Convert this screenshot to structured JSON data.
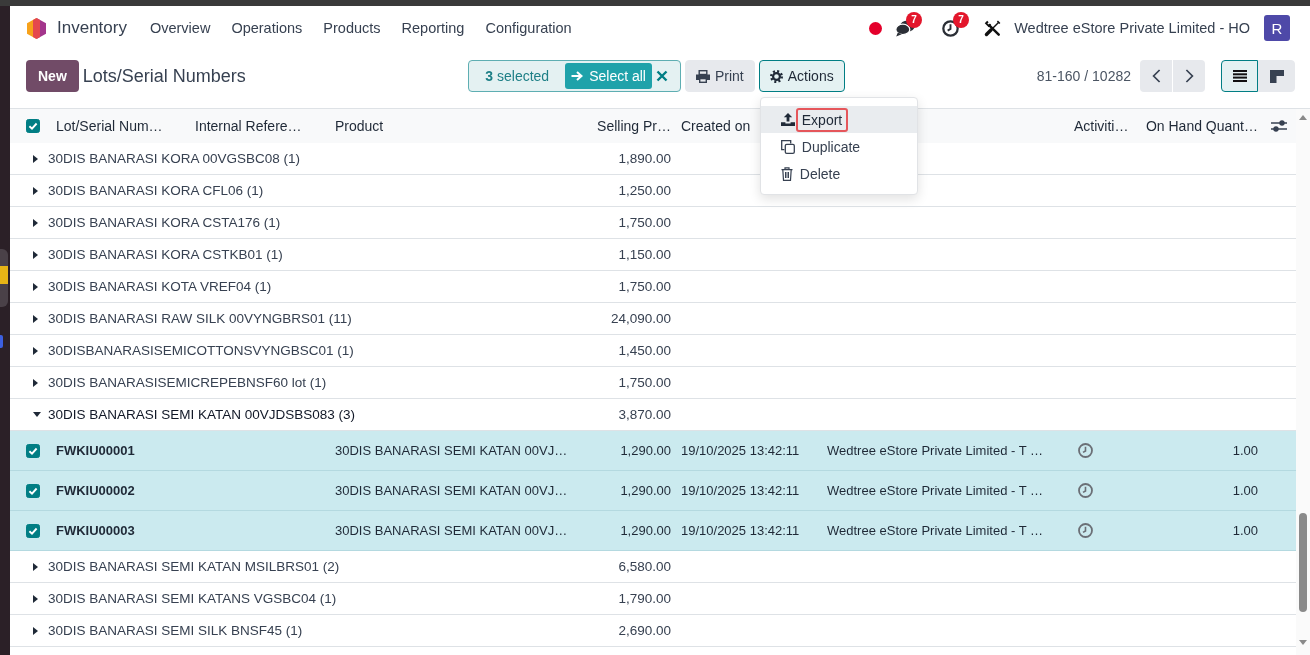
{
  "navbar": {
    "app_name": "Inventory",
    "menus": [
      "Overview",
      "Operations",
      "Products",
      "Reporting",
      "Configuration"
    ],
    "systray": [
      {
        "kind": "dot"
      },
      {
        "kind": "chat",
        "badge": "7"
      },
      {
        "kind": "activity",
        "badge": "7"
      },
      {
        "kind": "tools"
      }
    ],
    "company": "Wedtree eStore Private Limited - HO",
    "avatar_initial": "R"
  },
  "control_panel": {
    "new_button": "New",
    "title": "Lots/Serial Numbers",
    "selection": {
      "text": "**3** selected",
      "select_all": "Select all"
    },
    "buttons": [
      {
        "kind": "print",
        "label": "Print",
        "open": false
      },
      {
        "kind": "actions",
        "label": "Actions",
        "open": true,
        "menu": [
          {
            "kind": "export",
            "label": "Export",
            "focused": true,
            "annotated": true
          },
          {
            "kind": "duplicate",
            "label": "Duplicate",
            "focused": false,
            "annotated": false
          },
          {
            "kind": "delete",
            "label": "Delete",
            "focused": false,
            "annotated": false
          }
        ]
      }
    ],
    "pager": "81-160 / 10282",
    "views": [
      {
        "kind": "list",
        "selected": true
      },
      {
        "kind": "kanban",
        "selected": false
      }
    ]
  },
  "table": {
    "all_checked": true,
    "columns": [
      "Lot/Serial Num…",
      "Internal Refere…",
      "Product",
      "Selling Pr…",
      "Created on",
      "Activiti…",
      "On Hand Quant…"
    ],
    "groups": [
      {
        "label": "30DIS BANARASI KORA 00VGSBC08 (1)",
        "price": "1,890.00",
        "expanded": false
      },
      {
        "label": "30DIS BANARASI KORA CFL06 (1)",
        "price": "1,250.00",
        "expanded": false
      },
      {
        "label": "30DIS BANARASI KORA CSTA176 (1)",
        "price": "1,750.00",
        "expanded": false
      },
      {
        "label": "30DIS BANARASI KORA CSTKB01 (1)",
        "price": "1,150.00",
        "expanded": false
      },
      {
        "label": "30DIS BANARASI KOTA VREF04 (1)",
        "price": "1,750.00",
        "expanded": false
      },
      {
        "label": "30DIS BANARASI RAW SILK 00VYNGBRS01 (11)",
        "price": "24,090.00",
        "expanded": false
      },
      {
        "label": "30DISBANARASISEMICOTTONSVYNGBSC01 (1)",
        "price": "1,450.00",
        "expanded": false
      },
      {
        "label": "30DIS BANARASISEMICREPEBNSF60 lot (1)",
        "price": "1,750.00",
        "expanded": false
      },
      {
        "label": "30DIS BANARASI SEMI KATAN 00VJDSBS083 (3)",
        "price": "3,870.00",
        "expanded": true,
        "children": [
          {
            "lot": "FWKIU00001",
            "product": "30DIS BANARASI SEMI KATAN 00VJ…",
            "price": "1,290.00",
            "created_on": "19/10/2025 13:42:11",
            "column_6": "Wedtree eStore Private Limited - T …",
            "quantity": "1.00",
            "selected": true
          },
          {
            "lot": "FWKIU00002",
            "product": "30DIS BANARASI SEMI KATAN 00VJ…",
            "price": "1,290.00",
            "created_on": "19/10/2025 13:42:11",
            "column_6": "Wedtree eStore Private Limited - T …",
            "quantity": "1.00",
            "selected": true
          },
          {
            "lot": "FWKIU00003",
            "product": "30DIS BANARASI SEMI KATAN 00VJ…",
            "price": "1,290.00",
            "created_on": "19/10/2025 13:42:11",
            "column_6": "Wedtree eStore Private Limited - T …",
            "quantity": "1.00",
            "selected": true
          }
        ]
      },
      {
        "label": "30DIS BANARASI SEMI KATAN MSILBRS01 (2)",
        "price": "6,580.00",
        "expanded": false
      },
      {
        "label": "30DIS BANARASI SEMI KATANS VGSBC04 (1)",
        "price": "1,790.00",
        "expanded": false
      },
      {
        "label": "30DIS BANARASI SEMI SILK BNSF45 (1)",
        "price": "2,690.00",
        "expanded": false
      }
    ]
  }
}
